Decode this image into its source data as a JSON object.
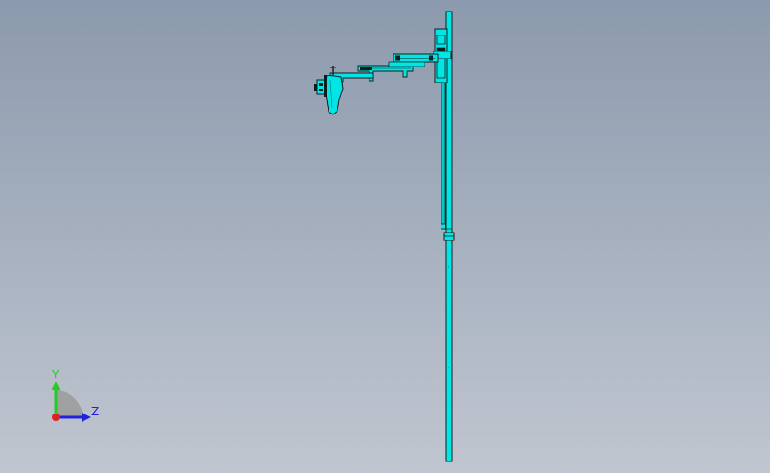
{
  "viewport": {
    "background_top": "#8c9aad",
    "background_bottom": "#c0c6d0",
    "model_color": "#00e5e5",
    "edge_color": "#1a1a1a"
  },
  "triad": {
    "y_label": "Y",
    "z_label": "Z",
    "y_color": "#22cc22",
    "z_color": "#2222dd",
    "x_color": "#dd2222"
  }
}
